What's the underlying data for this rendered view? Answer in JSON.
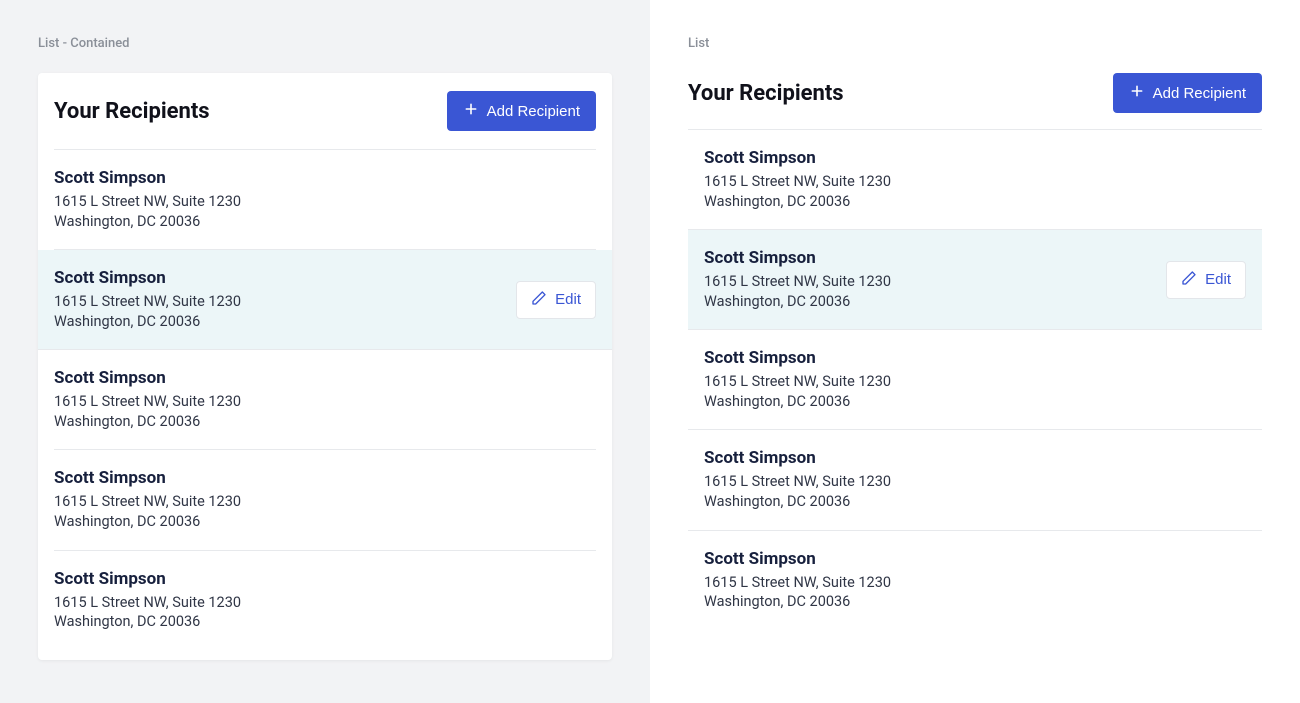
{
  "left": {
    "section_label": "List - Contained",
    "title": "Your Recipients",
    "add_button": "Add Recipient",
    "edit_label": "Edit",
    "items": [
      {
        "name": "Scott Simpson",
        "addr1": "1615 L Street NW, Suite 1230",
        "addr2": "Washington, DC 20036",
        "highlighted": false
      },
      {
        "name": "Scott Simpson",
        "addr1": "1615 L Street NW, Suite 1230",
        "addr2": "Washington, DC 20036",
        "highlighted": true
      },
      {
        "name": "Scott Simpson",
        "addr1": "1615 L Street NW, Suite 1230",
        "addr2": "Washington, DC 20036",
        "highlighted": false
      },
      {
        "name": "Scott Simpson",
        "addr1": "1615 L Street NW, Suite 1230",
        "addr2": "Washington, DC 20036",
        "highlighted": false
      },
      {
        "name": "Scott Simpson",
        "addr1": "1615 L Street NW, Suite 1230",
        "addr2": "Washington, DC 20036",
        "highlighted": false
      }
    ]
  },
  "right": {
    "section_label": "List",
    "title": "Your Recipients",
    "add_button": "Add Recipient",
    "edit_label": "Edit",
    "items": [
      {
        "name": "Scott Simpson",
        "addr1": "1615 L Street NW, Suite 1230",
        "addr2": "Washington, DC 20036",
        "highlighted": false
      },
      {
        "name": "Scott Simpson",
        "addr1": "1615 L Street NW, Suite 1230",
        "addr2": "Washington, DC 20036",
        "highlighted": true
      },
      {
        "name": "Scott Simpson",
        "addr1": "1615 L Street NW, Suite 1230",
        "addr2": "Washington, DC 20036",
        "highlighted": false
      },
      {
        "name": "Scott Simpson",
        "addr1": "1615 L Street NW, Suite 1230",
        "addr2": "Washington, DC 20036",
        "highlighted": false
      },
      {
        "name": "Scott Simpson",
        "addr1": "1615 L Street NW, Suite 1230",
        "addr2": "Washington, DC 20036",
        "highlighted": false
      }
    ]
  }
}
